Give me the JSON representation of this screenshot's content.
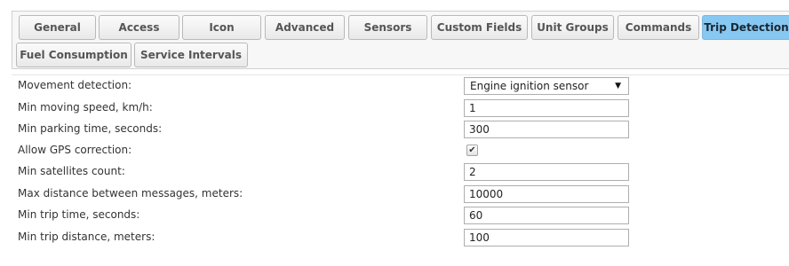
{
  "tabs": [
    {
      "label": "General"
    },
    {
      "label": "Access"
    },
    {
      "label": "Icon"
    },
    {
      "label": "Advanced"
    },
    {
      "label": "Sensors"
    },
    {
      "label": "Custom Fields"
    },
    {
      "label": "Unit Groups"
    },
    {
      "label": "Commands"
    },
    {
      "label": "Trip Detection",
      "active": true
    },
    {
      "label": "Fuel Consumption"
    },
    {
      "label": "Service Intervals"
    }
  ],
  "trip_detection": {
    "movement_detection": {
      "label": "Movement detection:",
      "value": "Engine ignition sensor"
    },
    "min_moving_speed": {
      "label": "Min moving speed, km/h:",
      "value": "1"
    },
    "min_parking_time": {
      "label": "Min parking time, seconds:",
      "value": "300"
    },
    "allow_gps_correction": {
      "label": "Allow GPS correction:",
      "checked": true
    },
    "min_satellites": {
      "label": "Min satellites count:",
      "value": "2"
    },
    "max_distance": {
      "label": "Max distance between messages, meters:",
      "value": "10000"
    },
    "min_trip_time": {
      "label": "Min trip time, seconds:",
      "value": "60"
    },
    "min_trip_distance": {
      "label": "Min trip distance, meters:",
      "value": "100"
    }
  },
  "icons": {
    "dropdown": "triangle-down-icon",
    "check": "checkmark-icon"
  },
  "colors": {
    "active_tab": "#87c8f2",
    "tab_text": "#555555",
    "label_text": "#333333"
  }
}
